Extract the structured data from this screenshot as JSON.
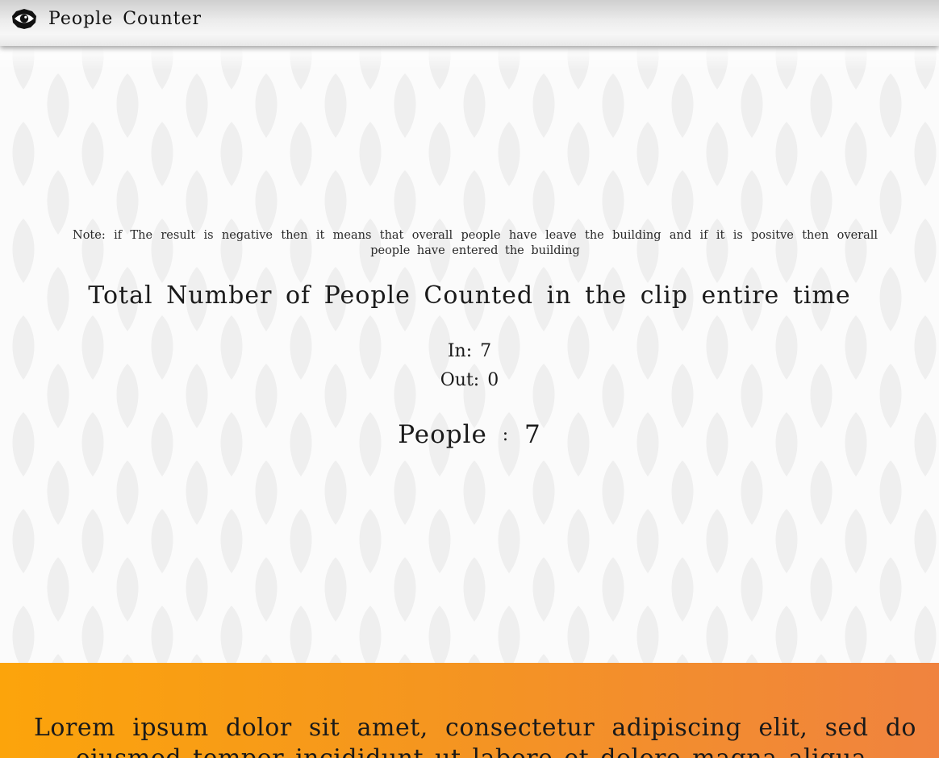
{
  "navbar": {
    "brand_icon": "eye-icon",
    "brand_label": "People Counter"
  },
  "main": {
    "note": "Note: if The result is negative then it means that overall people have leave the building and if it is positve then overall people have entered the building",
    "title": "Total Number of People Counted in the clip entire time",
    "in_label": "In:",
    "in_value": "7",
    "out_label": "Out:",
    "out_value": "0",
    "people_label": "People",
    "people_separator": ":",
    "people_value": "7"
  },
  "footer": {
    "text": "Lorem ipsum dolor sit amet, consectetur adipiscing elit, sed do eiusmod tempor incididunt ut labore et dolore magna aliqua."
  },
  "colors": {
    "footer_gradient_start": "#fca40b",
    "footer_gradient_end": "#f0833f",
    "pattern_leaf": "#efefef"
  }
}
